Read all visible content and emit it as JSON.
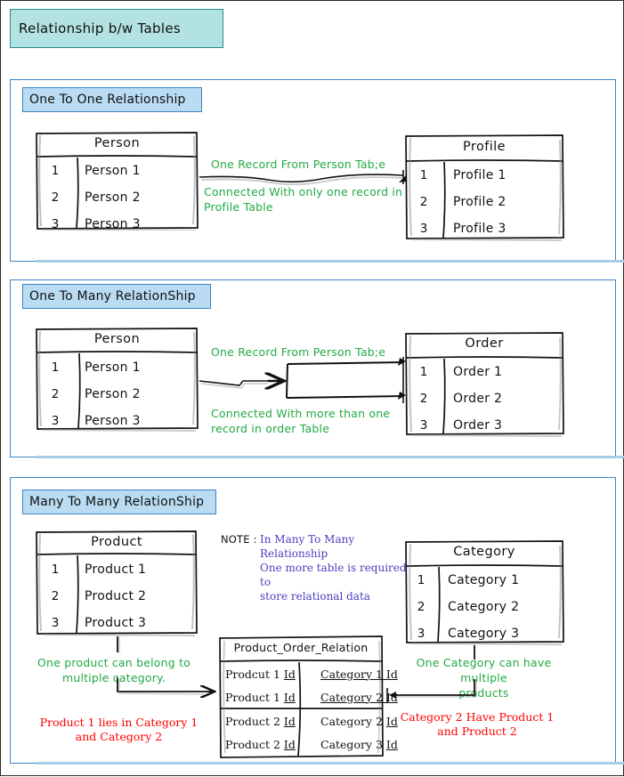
{
  "page": {
    "title": "Relationship b/w Tables",
    "border_color": "#2a2a2a",
    "title_box_fill": "#b3e2e2",
    "title_box_border": "#2e8b8b",
    "section_border": "#3b85c6",
    "section_label_fill": "#b9dcf2",
    "green": "#22aa44",
    "red": "#ff0000",
    "purple": "#4b3fbf"
  },
  "sections": [
    {
      "label": "One To One Relationship",
      "left_table": {
        "header": "Person",
        "rows": [
          {
            "id": "1",
            "value": "Person 1"
          },
          {
            "id": "2",
            "value": "Person 2"
          },
          {
            "id": "3",
            "value": "Person 3"
          }
        ]
      },
      "right_table": {
        "header": "Profile",
        "rows": [
          {
            "id": "1",
            "value": "Profile 1"
          },
          {
            "id": "2",
            "value": "Profile 2"
          },
          {
            "id": "3",
            "value": "Profile 3"
          }
        ]
      },
      "annotation_top": "One Record From Person Tab;e",
      "annotation_bottom": "Connected With only one record in\nProfile Table"
    },
    {
      "label": "One To Many RelationShip",
      "left_table": {
        "header": "Person",
        "rows": [
          {
            "id": "1",
            "value": "Person 1"
          },
          {
            "id": "2",
            "value": "Person 2"
          },
          {
            "id": "3",
            "value": "Person 3"
          }
        ]
      },
      "right_table": {
        "header": "Order",
        "rows": [
          {
            "id": "1",
            "value": "Order 1"
          },
          {
            "id": "2",
            "value": "Order 2"
          },
          {
            "id": "3",
            "value": "Order 3"
          }
        ]
      },
      "annotation_top": "One Record From Person Tab;e",
      "annotation_bottom": "Connected With more than one\nrecord in order Table"
    },
    {
      "label": "Many To Many RelationShip",
      "left_table": {
        "header": "Product",
        "rows": [
          {
            "id": "1",
            "value": "Product 1"
          },
          {
            "id": "2",
            "value": "Product 2"
          },
          {
            "id": "3",
            "value": "Product 3"
          }
        ]
      },
      "right_table": {
        "header": "Category",
        "rows": [
          {
            "id": "1",
            "value": "Category 1"
          },
          {
            "id": "2",
            "value": "Category 2"
          },
          {
            "id": "3",
            "value": "Category 3"
          }
        ]
      },
      "note_label": "NOTE :",
      "note_body": "In Many To Many Relationship\nOne more table is required to\nstore relational data",
      "junction_table": {
        "header": "Product_Order_Relation",
        "rows": [
          {
            "left_text": "Prodcut 1 ",
            "left_underlined": "Id",
            "right_text": "Category 1 Id",
            "right_all_underlined": true
          },
          {
            "left_text": "Product 1 ",
            "left_underlined": "Id",
            "right_text": "Category 2 Id",
            "right_all_underlined": true
          },
          {
            "left_text": "Product 2 ",
            "left_underlined": "Id",
            "right_text": "Category 2 ",
            "right_underlined": "Id",
            "right_all_underlined": false
          },
          {
            "left_text": "Product 2 ",
            "left_underlined": "Id",
            "right_text": "Category 3 ",
            "right_underlined": "Id",
            "right_all_underlined": false
          }
        ]
      },
      "annotation_left_green": "One product can belong to\nmultiple category.",
      "annotation_right_green": "One Category can have multiple\nproducts",
      "annotation_left_red": "Product 1 lies in Category 1\nand Category 2",
      "annotation_right_red": "Category 2 Have Product 1\nand Product 2"
    }
  ]
}
